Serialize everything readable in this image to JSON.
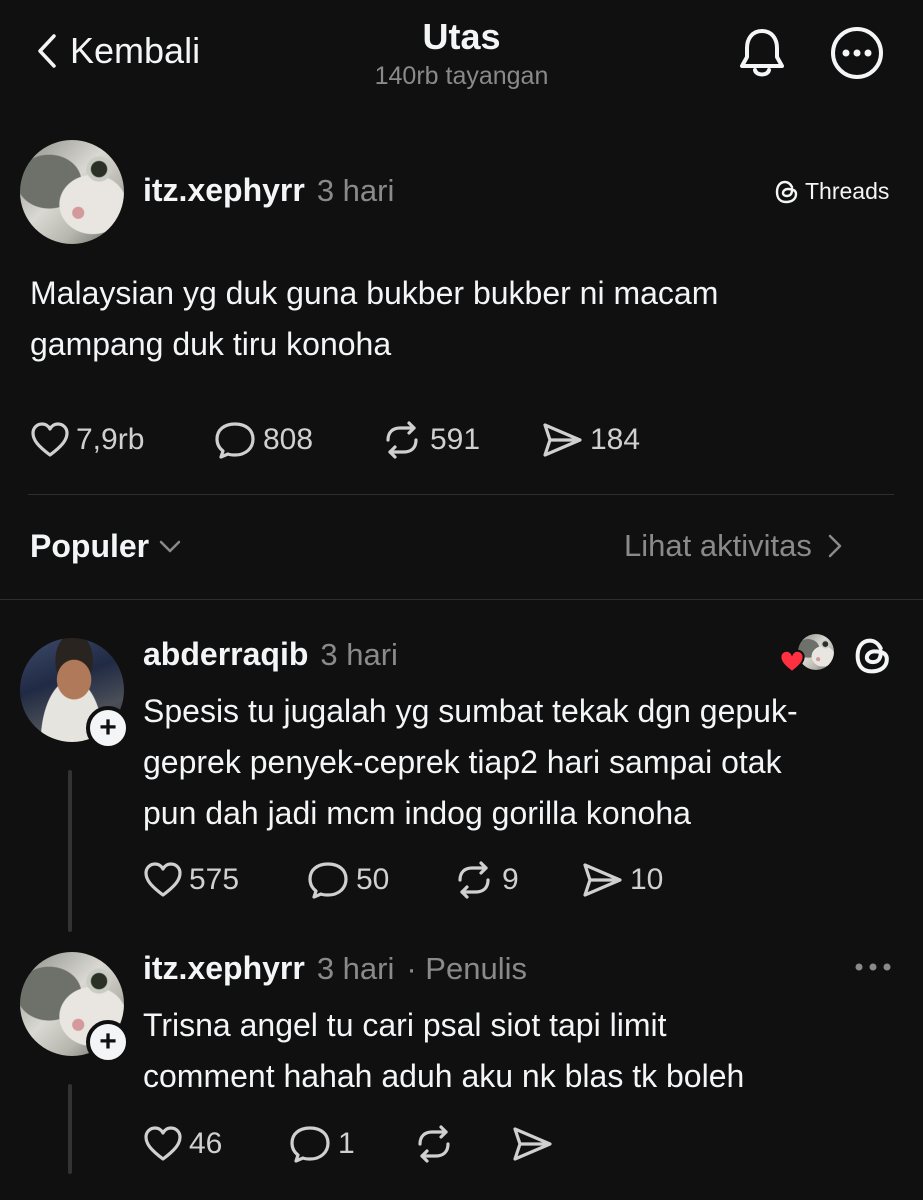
{
  "header": {
    "back_label": "Kembali",
    "title": "Utas",
    "views": "140rb tayangan"
  },
  "post": {
    "username": "itz.xephyrr",
    "time": "3 hari",
    "badge": "Threads",
    "text_line1": "Malaysian yg duk guna bukber bukber ni macam",
    "text_line2": "gampang duk tiru konoha",
    "likes": "7,9rb",
    "comments": "808",
    "reposts": "591",
    "shares": "184"
  },
  "sort": {
    "label": "Populer",
    "activity_label": "Lihat aktivitas"
  },
  "replies": [
    {
      "username": "abderraqib",
      "time": "3 hari",
      "line1": "Spesis tu jugalah yg sumbat tekak dgn gepuk-",
      "line2": "geprek penyek-ceprek tiap2 hari sampai otak",
      "line3": "pun dah jadi mcm indog gorilla konoha",
      "likes": "575",
      "comments": "50",
      "reposts": "9",
      "shares": "10"
    },
    {
      "username": "itz.xephyrr",
      "time": "3 hari",
      "author_tag": "· Penulis",
      "line1": "Trisna angel tu cari psal siot tapi limit",
      "line2": "comment hahah aduh aku nk blas tk boleh",
      "likes": "46",
      "comments": "1"
    }
  ],
  "colors": {
    "background": "#101010",
    "text": "#f3f5f7",
    "muted": "#8a8a8a",
    "heart": "#ff3040"
  }
}
